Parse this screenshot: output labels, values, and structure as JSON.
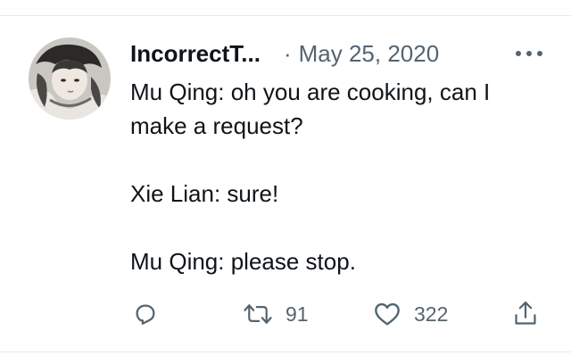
{
  "tweet": {
    "author_name": "IncorrectT...",
    "separator": "·",
    "date": "May 25, 2020",
    "more_icon": "more-horizontal-icon",
    "avatar_icon": "avatar",
    "text_lines": [
      "Mu Qing: oh you are cooking, can I make a request?",
      "Xie Lian: sure!",
      "Mu Qing: please stop."
    ]
  },
  "actions": {
    "reply_icon": "reply-icon",
    "retweet_icon": "retweet-icon",
    "retweet_count": "91",
    "like_icon": "heart-icon",
    "like_count": "322",
    "share_icon": "share-icon"
  },
  "colors": {
    "text": "#0f1419",
    "secondary": "#536471",
    "divider": "#e6e9ec"
  }
}
